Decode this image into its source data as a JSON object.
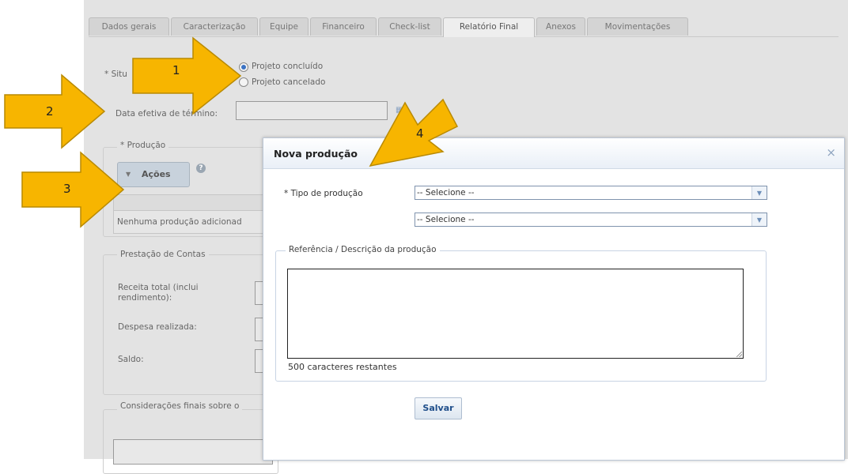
{
  "tabs": [
    "Dados gerais",
    "Caracterização",
    "Equipe",
    "Financeiro",
    "Check-list",
    "Relatório Final",
    "Anexos",
    "Movimentações"
  ],
  "active_tab": "Relatório Final",
  "situacao": {
    "label": "* Situ",
    "options": [
      "Projeto concluído",
      "Projeto cancelado"
    ],
    "selected": "Projeto concluído"
  },
  "data_efetiva": {
    "label": "Data efetiva de término:",
    "value": ""
  },
  "producao": {
    "legend": "* Produção",
    "acoes_label": "Ações",
    "empty_text": "Nenhuma produção adicionad"
  },
  "prestacao": {
    "legend": "Prestação de Contas",
    "receita_line1": "Receita total (inclui",
    "receita_line2": "rendimento):",
    "despesa": "Despesa realizada:",
    "saldo": "Saldo:"
  },
  "consideracoes": {
    "legend": "Considerações finais sobre o"
  },
  "dialog": {
    "title": "Nova produção",
    "tipo_label": "* Tipo de produção",
    "select1": "-- Selecione --",
    "select2": "-- Selecione --",
    "ref_legend": "Referência / Descrição da produção",
    "textarea_value": "",
    "counter": "500 caracteres restantes",
    "save_label": "Salvar",
    "close_glyph": "×"
  },
  "annotations": {
    "arrow_labels": [
      "1",
      "2",
      "3",
      "4"
    ],
    "arrow_color": "#f7b500"
  }
}
